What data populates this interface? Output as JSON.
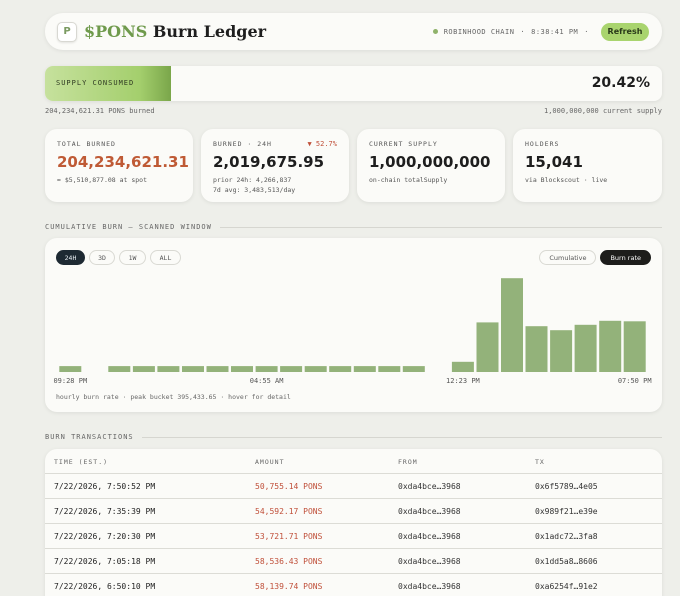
{
  "header": {
    "logo_glyph": "P",
    "brand_ticker": "$PONS",
    "brand_rest": "Burn Ledger",
    "chain": "ROBINHOOD CHAIN",
    "separator": "·",
    "time": "8:38:41 PM",
    "refresh_label": "Refresh"
  },
  "supply": {
    "label": "SUPPLY CONSUMED",
    "percent": "20.42%",
    "fill_fraction": 0.2042,
    "burned_text": "204,234,621.31 PONS burned",
    "current_text": "1,000,000,000 current supply"
  },
  "cards": [
    {
      "label": "TOTAL BURNED",
      "value": "204,234,621.31",
      "sub": "≈ $5,510,877.08 at spot"
    },
    {
      "label": "BURNED · 24H",
      "delta": "▼ 52.7%",
      "value": "2,019,675.95",
      "sub1": "prior 24h: 4,266,837",
      "sub2": "7d avg: 3,483,513/day"
    },
    {
      "label": "CURRENT SUPPLY",
      "value": "1,000,000,000",
      "sub": "on-chain totalSupply"
    },
    {
      "label": "HOLDERS",
      "value": "15,041",
      "sub": "via Blockscout · live"
    }
  ],
  "chart_section_title": "CUMULATIVE BURN — SCANNED WINDOW",
  "range_tabs": [
    "24H",
    "3D",
    "1W",
    "ALL"
  ],
  "mode_tabs": [
    "Cumulative",
    "Burn rate"
  ],
  "chart_footer": "hourly burn rate · peak bucket 395,433.65 · hover for detail",
  "chart_data": {
    "type": "bar",
    "title": "",
    "x_tick_labels": [
      "09:28 PM",
      "04:55 AM",
      "12:23 PM",
      "07:50 PM"
    ],
    "values": [
      22000,
      0,
      22000,
      22000,
      22000,
      22000,
      22000,
      22000,
      22000,
      22000,
      22000,
      22000,
      22000,
      22000,
      22000,
      0,
      38000,
      184000,
      348000,
      170000,
      155000,
      175000,
      190000,
      188000
    ],
    "peak": 395433.65,
    "color": "#93b27a"
  },
  "tx_section_title": "BURN TRANSACTIONS",
  "table": {
    "headers": [
      "TIME (EST.)",
      "AMOUNT",
      "FROM",
      "TX"
    ],
    "rows": [
      [
        "7/22/2026, 7:50:52 PM",
        "50,755.14 PONS",
        "0xda4bce…3968",
        "0x6f5789…4e05"
      ],
      [
        "7/22/2026, 7:35:39 PM",
        "54,592.17 PONS",
        "0xda4bce…3968",
        "0x989f21…e39e"
      ],
      [
        "7/22/2026, 7:20:30 PM",
        "53,721.71 PONS",
        "0xda4bce…3968",
        "0x1adc72…3fa8"
      ],
      [
        "7/22/2026, 7:05:18 PM",
        "58,536.43 PONS",
        "0xda4bce…3968",
        "0x1dd5a8…8606"
      ],
      [
        "7/22/2026, 6:50:10 PM",
        "58,139.74 PONS",
        "0xda4bce…3968",
        "0xa6254f…91e2"
      ]
    ]
  },
  "colors": {
    "accent": "#a9d46e",
    "brand_green": "#6f9a4c",
    "rust": "#bf5a35",
    "bar": "#93b27a",
    "negative": "#c0503a"
  }
}
